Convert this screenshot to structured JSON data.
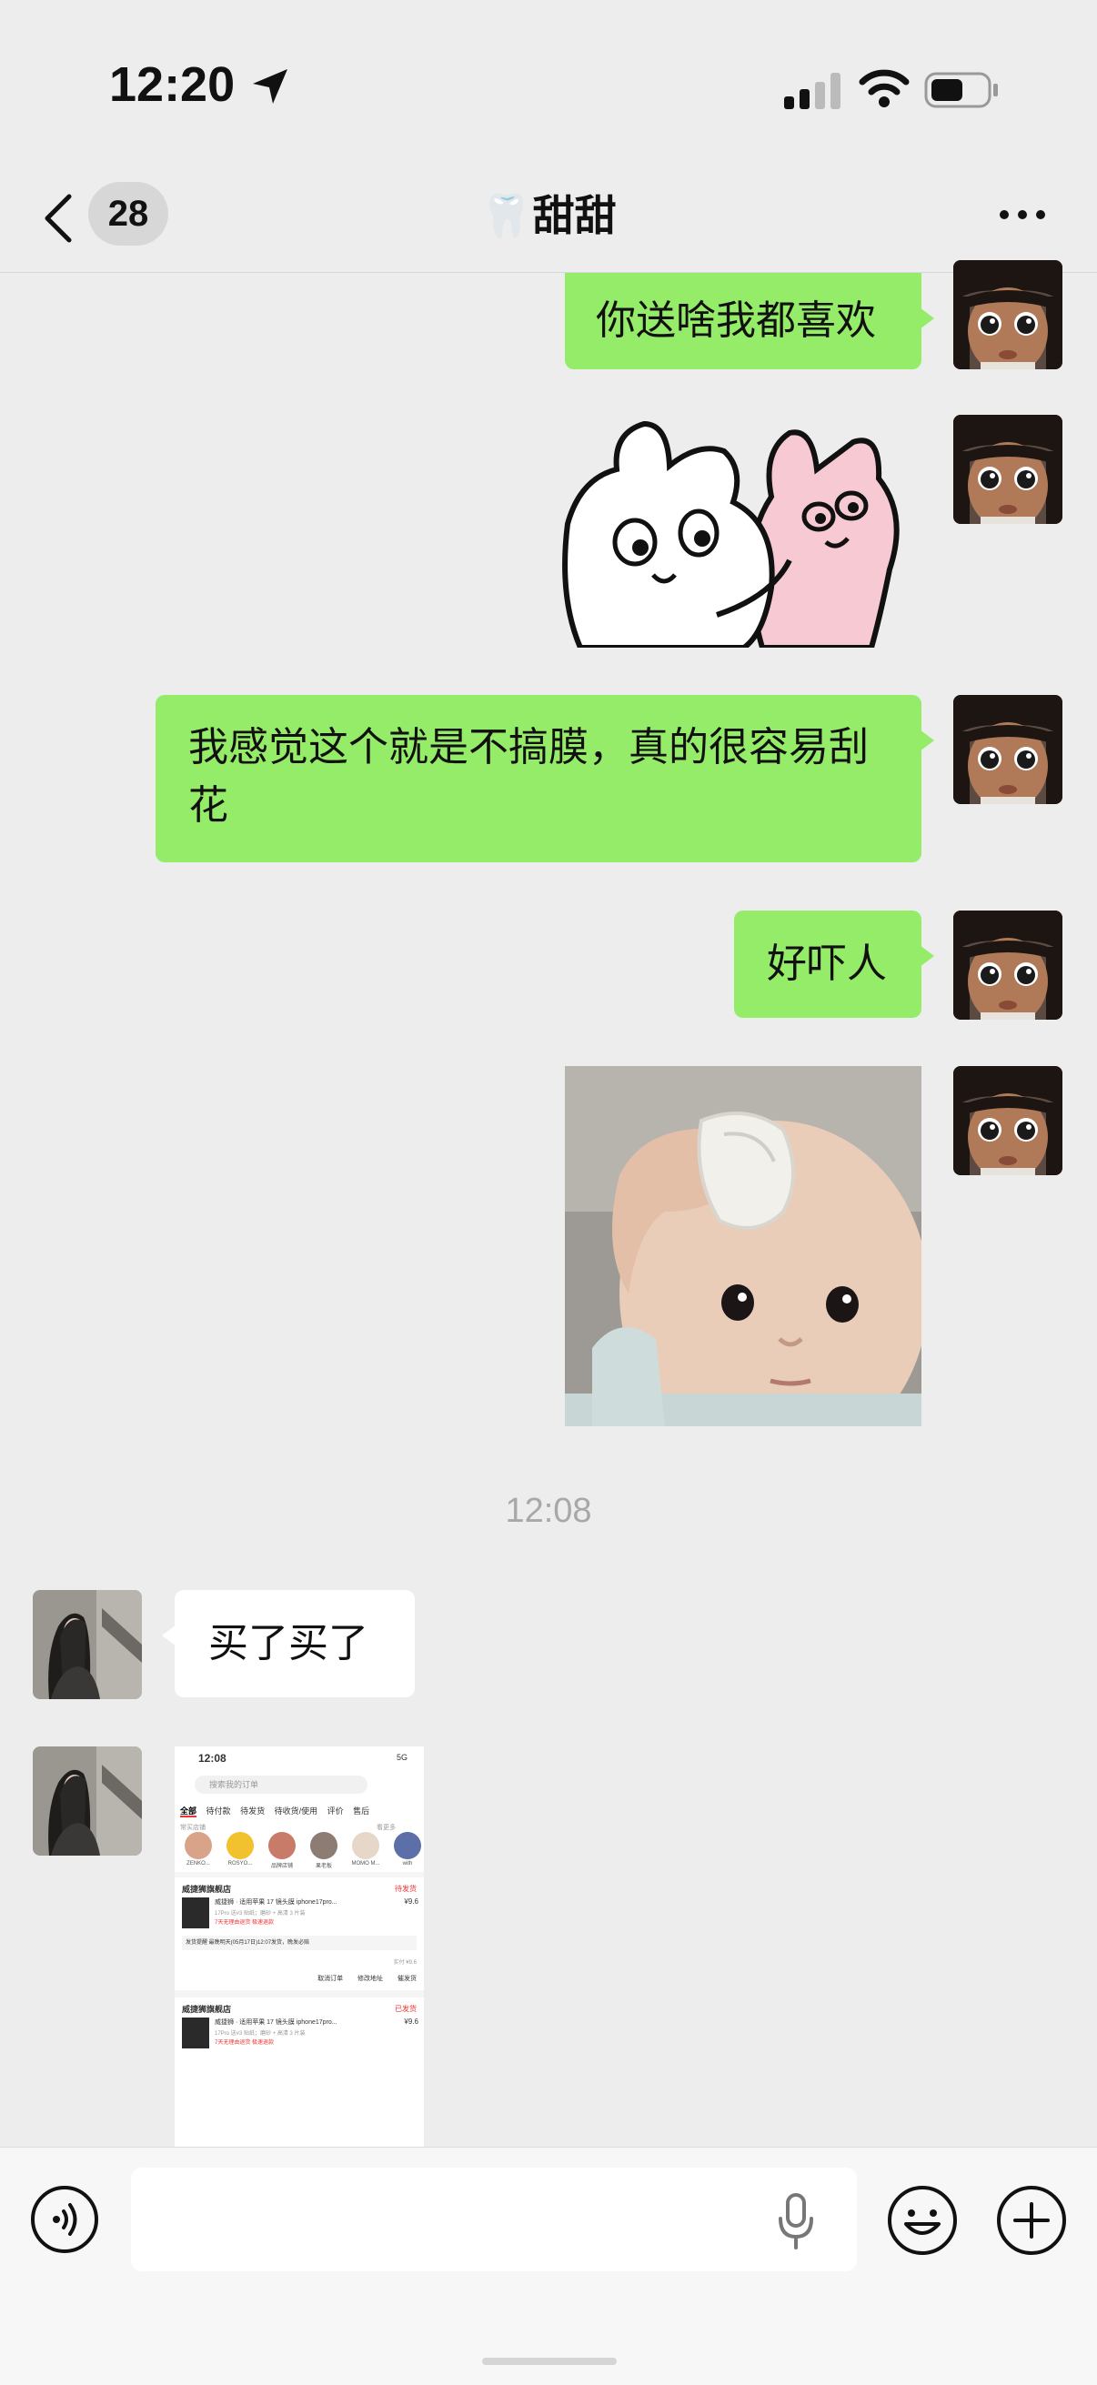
{
  "status_bar": {
    "time": "12:20",
    "icons": [
      "location-arrow-icon",
      "cellular-signal-icon",
      "wifi-icon",
      "battery-icon"
    ]
  },
  "nav": {
    "unread_count": "28",
    "title": "🦷甜甜",
    "icons": [
      "back-chevron-icon",
      "more-dots-icon"
    ]
  },
  "messages": [
    {
      "sender": "me",
      "type": "text",
      "text": "你送啥我都喜欢"
    },
    {
      "sender": "me",
      "type": "sticker",
      "sticker": "hugging-bunnies-sticker"
    },
    {
      "sender": "me",
      "type": "text",
      "text": "我感觉这个就是不搞膜，真的很容易刮花"
    },
    {
      "sender": "me",
      "type": "text",
      "text": "好吓人"
    },
    {
      "sender": "me",
      "type": "sticker",
      "sticker": "baby-wiping-forehead-sticker"
    },
    {
      "sender": "system",
      "type": "timestamp",
      "text": "12:08"
    },
    {
      "sender": "them",
      "type": "text",
      "text": "买了买了"
    },
    {
      "sender": "them",
      "type": "image",
      "image": "order-list-screenshot"
    }
  ],
  "screenshot_thumb": {
    "time": "12:08",
    "network": "5G",
    "search_placeholder": "搜索我的订单",
    "tabs": [
      "全部",
      "待付款",
      "待发货",
      "待收货/使用",
      "评价",
      "售后"
    ],
    "active_tab": "全部",
    "subheading": "常买店铺",
    "see_more": "看更多",
    "stores": [
      "ZENKO...",
      "ROSYO...",
      "品牌店铺",
      "果老板",
      "MOMO M...",
      "with"
    ],
    "orders": [
      {
        "shop": "威捷狮旗舰店",
        "status": "待发货",
        "title": "威捷狮 · 适用苹果 17 镜头膜 iphone17pro...",
        "spec": "17Pro 送#3 贴纸；磨砂 + 高清 3 片装",
        "promo": "7天无理由退货  极速退款",
        "price": "¥9.6",
        "note": "发货提醒  最晚明天(05月17日)12:07发货，晚发必赔",
        "paid": "实付 ¥9.6",
        "buttons": [
          "取消订单",
          "修改地址",
          "催发货"
        ]
      },
      {
        "shop": "威捷狮旗舰店",
        "status": "已发货",
        "title": "威捷狮 · 适用苹果 17 镜头膜 iphone17pro...",
        "spec": "17Pro 送#3 贴纸；磨砂 + 高清 3 片装",
        "promo": "7天无理由退货  极速退款",
        "price": "¥9.6"
      }
    ]
  },
  "input_bar": {
    "placeholder": "",
    "icons": [
      "voice-toggle-icon",
      "microphone-icon",
      "emoji-icon",
      "plus-icon"
    ]
  },
  "colors": {
    "background": "#ededed",
    "my_bubble": "#95ec69",
    "their_bubble": "#ffffff",
    "timestamp": "#a8a8a8"
  }
}
